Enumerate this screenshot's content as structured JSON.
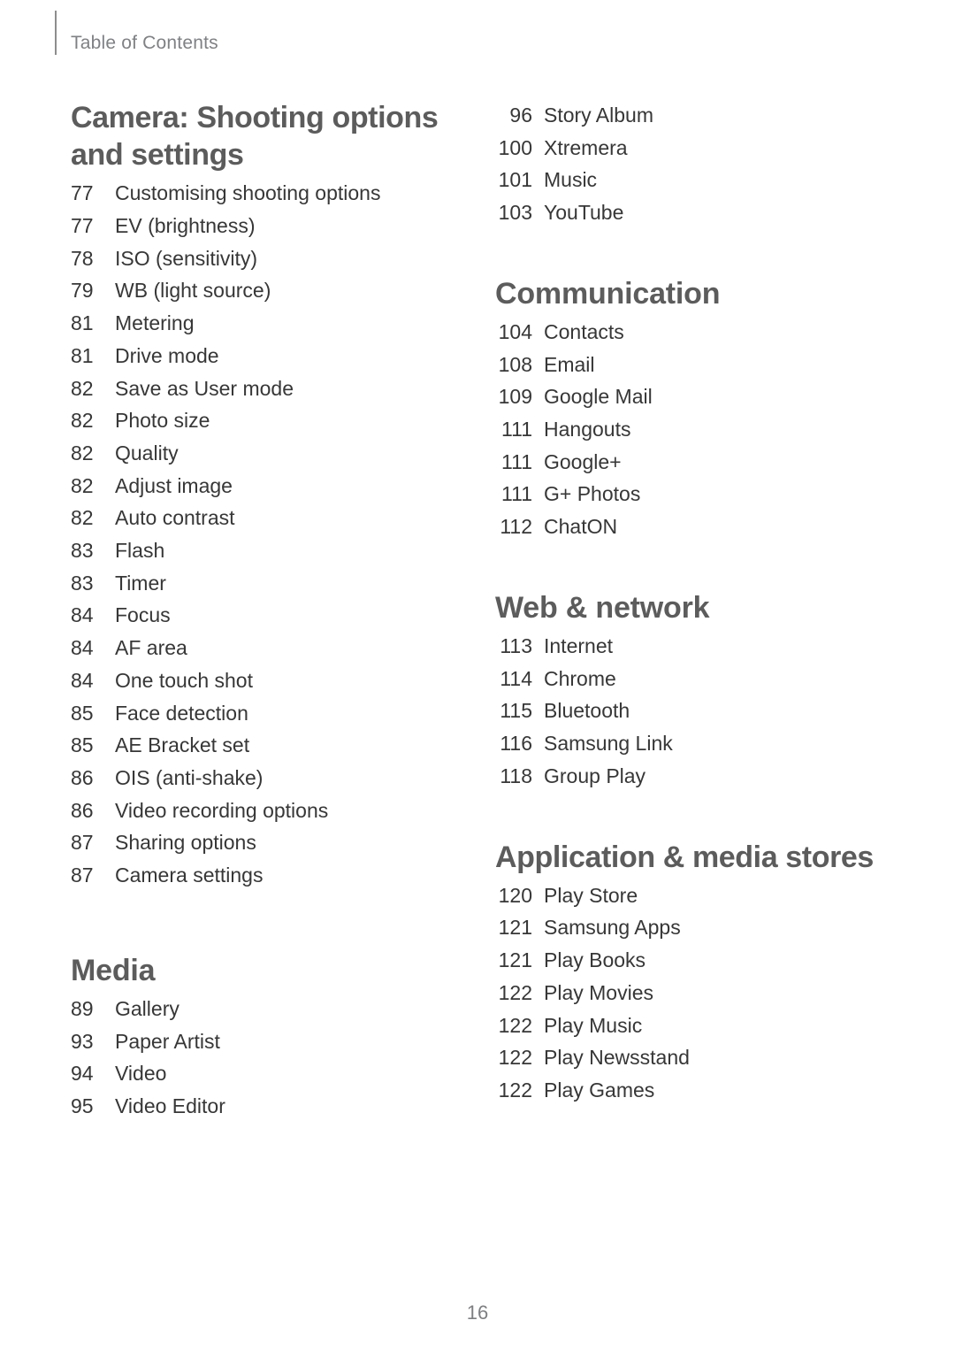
{
  "header": {
    "running_label": "Table of Contents"
  },
  "folio": {
    "page_number": "16"
  },
  "colors": {
    "section_heading": "#5c5c5c",
    "body_text": "#373737",
    "running_header": "#7f8184",
    "rule": "#8d8d8d",
    "background": "#ffffff"
  },
  "columns": {
    "left": {
      "sections": [
        {
          "title": "Camera: Shooting options and settings",
          "entries": [
            {
              "page": "77",
              "label": "Customising shooting options"
            },
            {
              "page": "77",
              "label": "EV (brightness)"
            },
            {
              "page": "78",
              "label": "ISO (sensitivity)"
            },
            {
              "page": "79",
              "label": "WB (light source)"
            },
            {
              "page": "81",
              "label": "Metering"
            },
            {
              "page": "81",
              "label": "Drive mode"
            },
            {
              "page": "82",
              "label": "Save as User mode"
            },
            {
              "page": "82",
              "label": "Photo size"
            },
            {
              "page": "82",
              "label": "Quality"
            },
            {
              "page": "82",
              "label": "Adjust image"
            },
            {
              "page": "82",
              "label": "Auto contrast"
            },
            {
              "page": "83",
              "label": "Flash"
            },
            {
              "page": "83",
              "label": "Timer"
            },
            {
              "page": "84",
              "label": "Focus"
            },
            {
              "page": "84",
              "label": "AF area"
            },
            {
              "page": "84",
              "label": "One touch shot"
            },
            {
              "page": "85",
              "label": "Face detection"
            },
            {
              "page": "85",
              "label": "AE Bracket set"
            },
            {
              "page": "86",
              "label": "OIS (anti-shake)"
            },
            {
              "page": "86",
              "label": "Video recording options"
            },
            {
              "page": "87",
              "label": "Sharing options"
            },
            {
              "page": "87",
              "label": "Camera settings"
            }
          ]
        },
        {
          "title": "Media",
          "entries": [
            {
              "page": "89",
              "label": "Gallery"
            },
            {
              "page": "93",
              "label": "Paper Artist"
            },
            {
              "page": "94",
              "label": "Video"
            },
            {
              "page": "95",
              "label": "Video Editor"
            }
          ]
        }
      ]
    },
    "right": {
      "sections": [
        {
          "title": "",
          "entries": [
            {
              "page": "96",
              "label": "Story Album"
            },
            {
              "page": "100",
              "label": "Xtremera"
            },
            {
              "page": "101",
              "label": "Music"
            },
            {
              "page": "103",
              "label": "YouTube"
            }
          ]
        },
        {
          "title": "Communication",
          "entries": [
            {
              "page": "104",
              "label": "Contacts"
            },
            {
              "page": "108",
              "label": "Email"
            },
            {
              "page": "109",
              "label": "Google Mail"
            },
            {
              "page": "111",
              "label": "Hangouts"
            },
            {
              "page": "111",
              "label": "Google+"
            },
            {
              "page": "111",
              "label": "G+ Photos"
            },
            {
              "page": "112",
              "label": "ChatON"
            }
          ]
        },
        {
          "title": "Web & network",
          "entries": [
            {
              "page": "113",
              "label": "Internet"
            },
            {
              "page": "114",
              "label": "Chrome"
            },
            {
              "page": "115",
              "label": "Bluetooth"
            },
            {
              "page": "116",
              "label": "Samsung Link"
            },
            {
              "page": "118",
              "label": "Group Play"
            }
          ]
        },
        {
          "title": "Application & media stores",
          "entries": [
            {
              "page": "120",
              "label": "Play Store"
            },
            {
              "page": "121",
              "label": "Samsung Apps"
            },
            {
              "page": "121",
              "label": "Play Books"
            },
            {
              "page": "122",
              "label": "Play Movies"
            },
            {
              "page": "122",
              "label": "Play Music"
            },
            {
              "page": "122",
              "label": "Play Newsstand"
            },
            {
              "page": "122",
              "label": "Play Games"
            }
          ]
        }
      ]
    }
  }
}
